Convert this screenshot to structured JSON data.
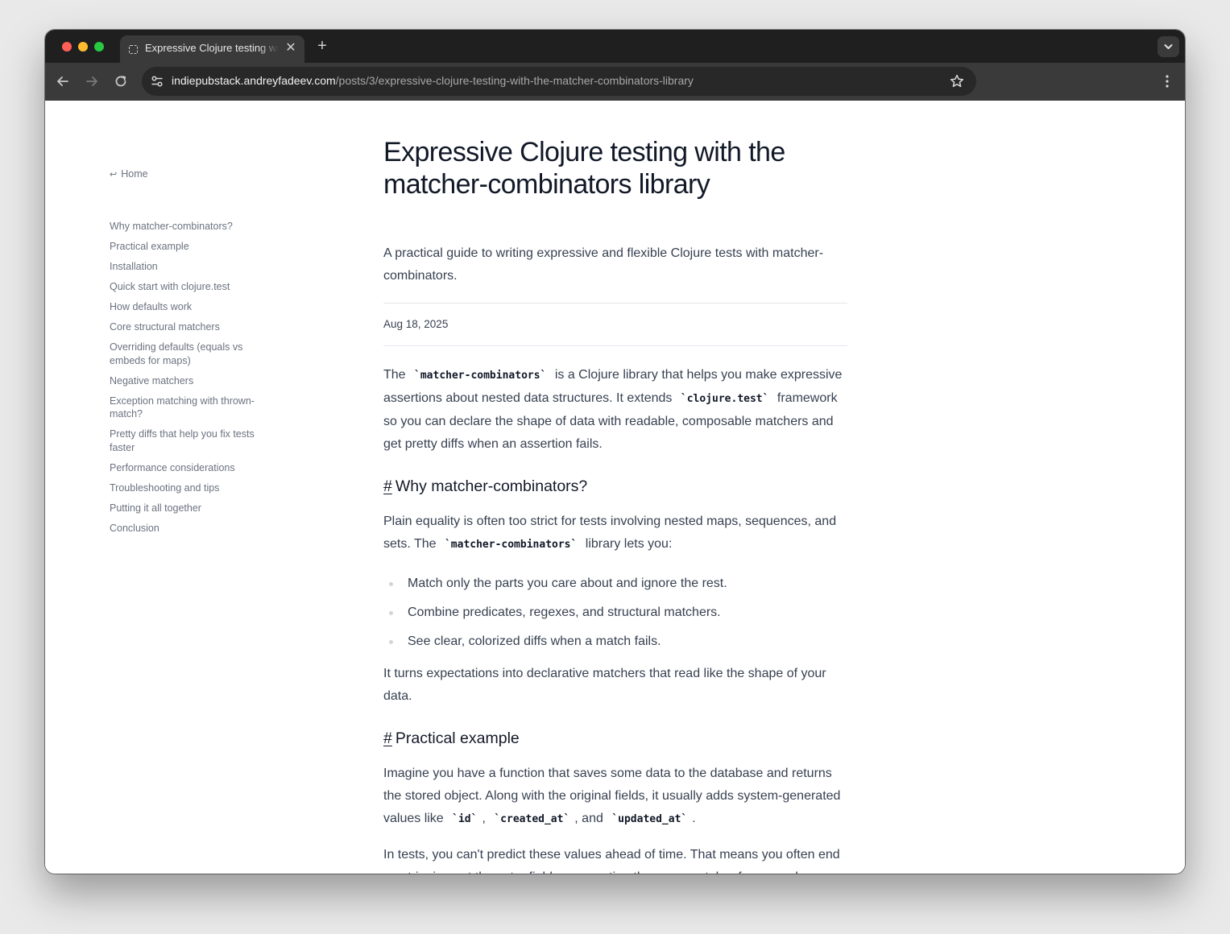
{
  "browser": {
    "tab": {
      "title": "Expressive Clojure testing with the matcher-combinators library",
      "close_label": "✕"
    },
    "new_tab_label": "+",
    "url": {
      "host": "indiepubstack.andreyfadeev.com",
      "path": "/posts/3/expressive-clojure-testing-with-the-matcher-combinators-library"
    }
  },
  "sidebar": {
    "home": {
      "arrow": "↩",
      "label": "Home"
    },
    "toc": [
      {
        "label": "Why matcher-combinators?"
      },
      {
        "label": "Practical example"
      },
      {
        "label": "Installation"
      },
      {
        "label": "Quick start with clojure.test"
      },
      {
        "label": "How defaults work"
      },
      {
        "label": "Core structural matchers"
      },
      {
        "label": "Overriding defaults (equals vs embeds for maps)"
      },
      {
        "label": "Negative matchers"
      },
      {
        "label": "Exception matching with thrown-match?"
      },
      {
        "label": "Pretty diffs that help you fix tests faster"
      },
      {
        "label": "Performance considerations"
      },
      {
        "label": "Troubleshooting and tips"
      },
      {
        "label": "Putting it all together"
      },
      {
        "label": "Conclusion"
      }
    ]
  },
  "article": {
    "title": "Expressive Clojure testing with the matcher-combinators library",
    "subtitle": "A practical guide to writing expressive and flexible Clojure tests with matcher-combinators.",
    "date": "Aug 18, 2025",
    "intro": {
      "t1": "The ",
      "c1": "`matcher-combinators`",
      "t2": " is a Clojure library that helps you make expressive assertions about nested data structures. It extends ",
      "c2": "`clojure.test`",
      "t3": " framework so you can declare the shape of data with readable, composable matchers and get pretty diffs when an assertion fails."
    },
    "section1": {
      "hash": "#",
      "heading": "Why matcher-combinators?",
      "p_t1": "Plain equality is often too strict for tests involving nested maps, sequences, and sets. The ",
      "p_c1": "`matcher-combinators`",
      "p_t2": " library lets you:",
      "bullets": [
        "Match only the parts you care about and ignore the rest.",
        "Combine predicates, regexes, and structural matchers.",
        "See clear, colorized diffs when a match fails."
      ],
      "closing": "It turns expectations into declarative matchers that read like the shape of your data."
    },
    "section2": {
      "hash": "#",
      "heading": "Practical example",
      "p1_t1": "Imagine you have a function that saves some data to the database and returns the stored object. Along with the original fields, it usually adds system-generated values like ",
      "p1_c1": "`id`",
      "p1_t2": ", ",
      "p1_c2": "`created_at`",
      "p1_t3": ", and ",
      "p1_c3": "`updated_at`",
      "p1_t4": ".",
      "p2": "In tests, you can't predict these values ahead of time. That means you often end up stripping out the extra fields or asserting them separately—for example"
    }
  }
}
